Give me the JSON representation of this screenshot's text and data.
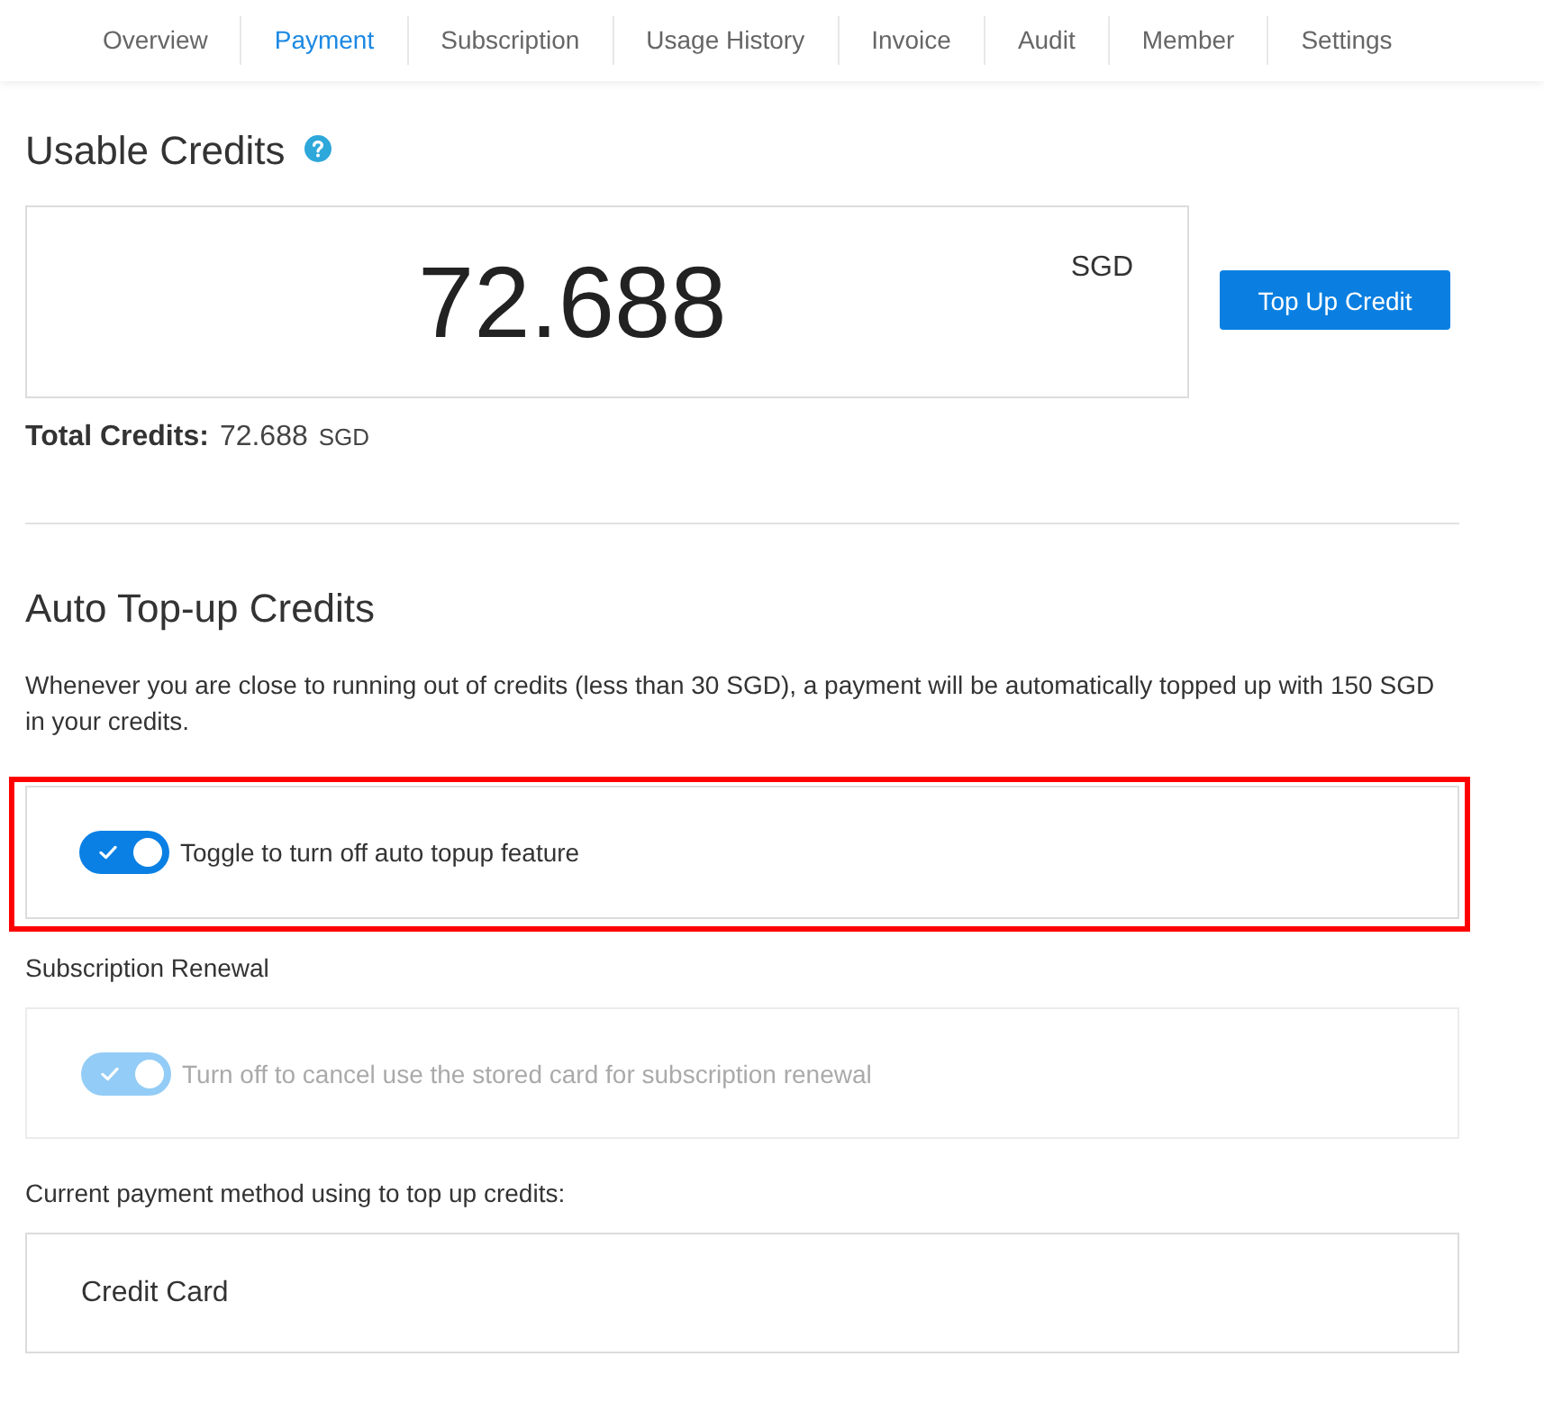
{
  "tabs": [
    {
      "label": "Overview",
      "selected": false
    },
    {
      "label": "Payment",
      "selected": true
    },
    {
      "label": "Subscription",
      "selected": false
    },
    {
      "label": "Usage History",
      "selected": false
    },
    {
      "label": "Invoice",
      "selected": false
    },
    {
      "label": "Audit",
      "selected": false
    },
    {
      "label": "Member",
      "selected": false
    },
    {
      "label": "Settings",
      "selected": false
    }
  ],
  "usable_credits": {
    "title": "Usable Credits",
    "amount": "72.688",
    "currency": "SGD",
    "button": "Top Up Credit"
  },
  "total_credits": {
    "label": "Total Credits:",
    "amount": "72.688",
    "currency": "SGD"
  },
  "auto_topup": {
    "title": "Auto Top-up Credits",
    "description": "Whenever you are close to running out of credits (less than 30 SGD), a payment will be automatically topped up with 150 SGD in your credits.",
    "toggle": {
      "label": "Toggle to turn off auto topup feature",
      "on": true,
      "disabled": false,
      "highlighted": true
    }
  },
  "subscription_renewal": {
    "title": "Subscription Renewal",
    "toggle": {
      "label": "Turn off to cancel use the stored card for subscription renewal",
      "on": true,
      "disabled": true,
      "highlighted": false
    }
  },
  "payment_method": {
    "label": "Current payment method using to top up credits:",
    "value": "Credit Card"
  }
}
